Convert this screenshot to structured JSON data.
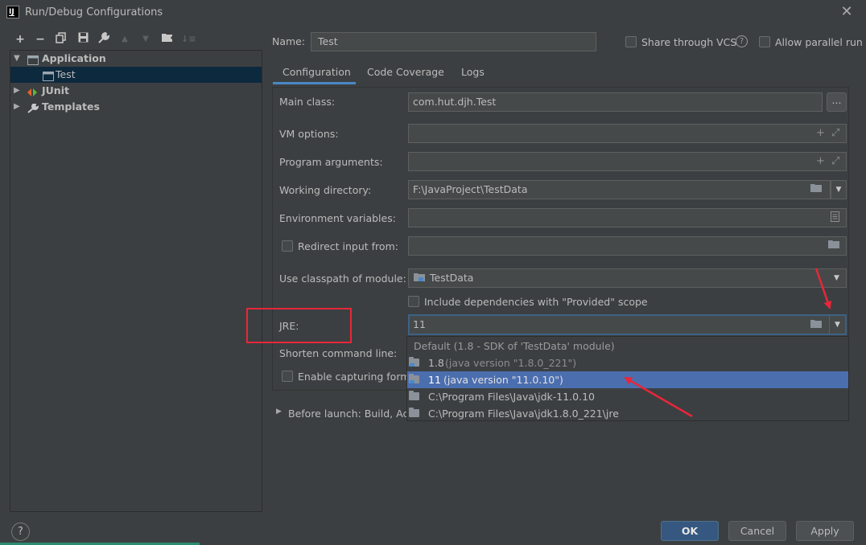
{
  "window": {
    "title": "Run/Debug Configurations",
    "icon_label": "IJ"
  },
  "toolbar": {
    "icons": [
      "add-icon",
      "remove-icon",
      "copy-icon",
      "save-icon",
      "wrench-icon",
      "move-up-icon",
      "move-down-icon",
      "folder-add-icon",
      "sort-icon"
    ]
  },
  "tree": {
    "items": [
      {
        "label": "Application",
        "expanded": true
      },
      {
        "label": "Test",
        "selected": true
      },
      {
        "label": "JUnit",
        "expanded": false
      },
      {
        "label": "Templates",
        "expanded": false
      }
    ]
  },
  "header": {
    "name_label": "Name:",
    "name_value": "Test",
    "share_label": "Share through VCS",
    "share_help": "?",
    "parallel_label": "Allow parallel run"
  },
  "tabs": [
    {
      "label": "Configuration",
      "active": true
    },
    {
      "label": "Code Coverage"
    },
    {
      "label": "Logs"
    }
  ],
  "form": {
    "main_class_label": "Main class:",
    "main_class_value": "com.hut.djh.Test",
    "dots_label": "...",
    "vm_options_label": "VM options:",
    "program_args_label": "Program arguments:",
    "working_dir_label": "Working directory:",
    "working_dir_value": "F:\\JavaProject\\TestData",
    "env_vars_label": "Environment variables:",
    "redirect_label": "Redirect input from:",
    "classpath_label": "Use classpath of module:",
    "classpath_value": "TestData",
    "include_deps_label": "Include dependencies with \"Provided\" scope",
    "jre_label": "JRE:",
    "jre_value": "11",
    "shorten_label": "Shorten command line:",
    "capture_label": "Enable capturing form",
    "before_launch_label": "Before launch: Build, Acti"
  },
  "jre_dropdown": {
    "header": "Default (1.8 - SDK of 'TestData' module)",
    "options": [
      {
        "name": "1.8",
        "detail": "(java version \"1.8.0_221\")",
        "type": "jdk"
      },
      {
        "name": "11",
        "detail": "(java version \"11.0.10\")",
        "type": "jdk",
        "selected": true
      },
      {
        "name": "C:\\Program Files\\Java\\jdk-11.0.10",
        "detail": "",
        "type": "folder"
      },
      {
        "name": "C:\\Program Files\\Java\\jdk1.8.0_221\\jre",
        "detail": "",
        "type": "folder"
      }
    ]
  },
  "footer": {
    "help": "?",
    "ok": "OK",
    "cancel": "Cancel",
    "apply": "Apply"
  },
  "colors": {
    "background": "#3c3f41",
    "selection": "#4b6eaf",
    "tree_selection": "#0d293e",
    "accent_tab": "#4a88c7",
    "annotation_red": "#e8263a"
  }
}
